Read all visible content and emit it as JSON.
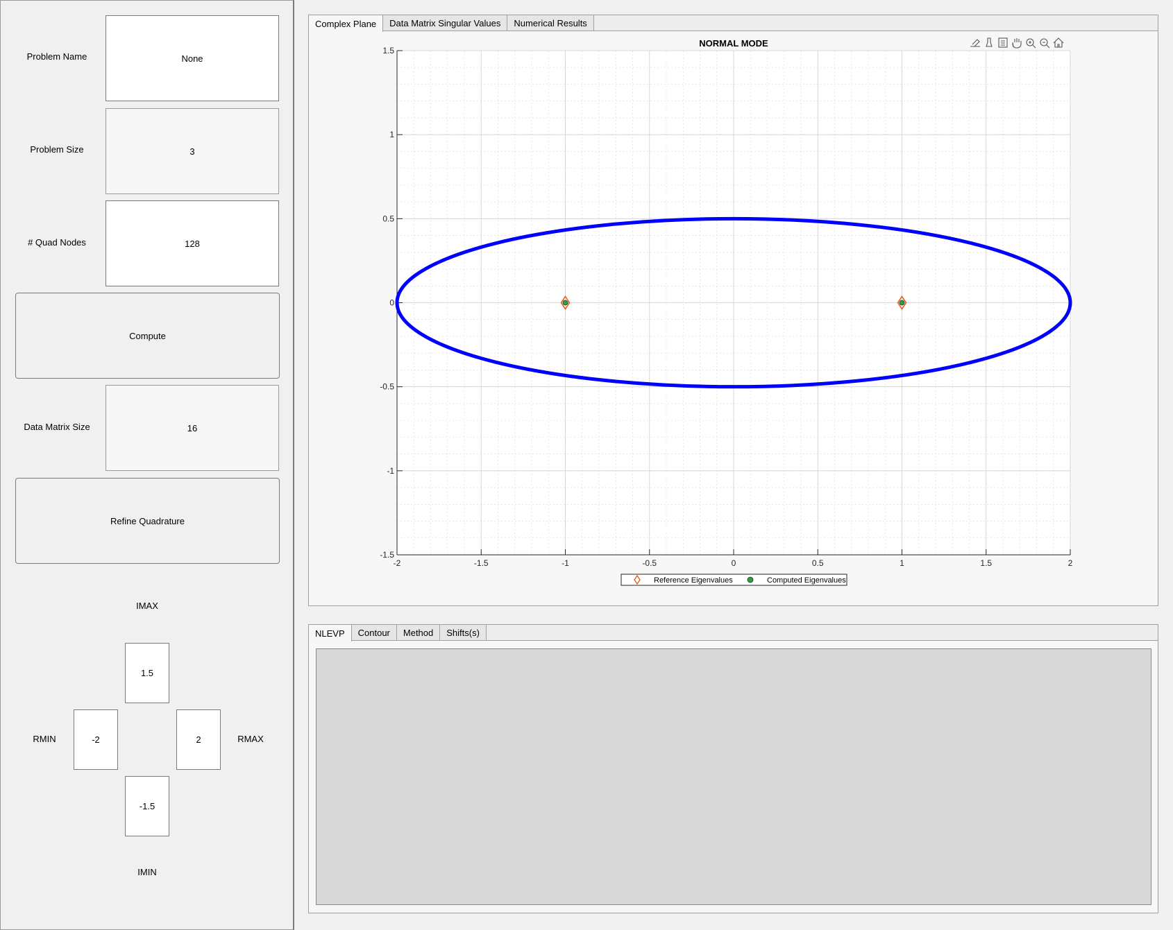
{
  "left": {
    "problem_name": {
      "label": "Problem Name",
      "value": "None"
    },
    "problem_size": {
      "label": "Problem Size",
      "value": "3"
    },
    "quad_nodes": {
      "label": "# Quad Nodes",
      "value": "128"
    },
    "compute_label": "Compute",
    "data_matrix_size": {
      "label": "Data Matrix Size",
      "value": "16"
    },
    "refine_label": "Refine Quadrature",
    "bounds": {
      "imax_label": "IMAX",
      "imax_value": "1.5",
      "rmin_label": "RMIN",
      "rmin_value": "-2",
      "rmax_label": "RMAX",
      "rmax_value": "2",
      "imin_label": "IMIN",
      "imin_value": "-1.5"
    }
  },
  "top_tabs": [
    "Complex Plane",
    "Data Matrix Singular Values",
    "Numerical Results"
  ],
  "bottom_tabs": [
    "NLEVP",
    "Contour",
    "Method",
    "Shifts(s)"
  ],
  "toolbar_icons": [
    "export-icon",
    "brush-icon",
    "data-tips-icon",
    "pan-hand-icon",
    "zoom-in-icon",
    "zoom-out-icon",
    "home-icon"
  ],
  "colors": {
    "contour": "#0000ff",
    "reference_marker": "#e05a10",
    "computed_marker": "#2e9e3e"
  },
  "chart_data": {
    "type": "scatter",
    "title": "NORMAL MODE",
    "xlabel": "",
    "ylabel": "",
    "xlim": [
      -2,
      2
    ],
    "ylim": [
      -1.5,
      1.5
    ],
    "xticks": [
      -2,
      -1.5,
      -1,
      -0.5,
      0,
      0.5,
      1,
      1.5,
      2
    ],
    "yticks": [
      -1.5,
      -1,
      -0.5,
      0,
      0.5,
      1,
      1.5
    ],
    "xtick_labels": [
      "-2",
      "-1.5",
      "-1",
      "-0.5",
      "0",
      "0.5",
      "1",
      "1.5",
      "2"
    ],
    "ytick_labels": [
      "-1.5",
      "-1",
      "-0.5",
      "0",
      "0.5",
      "1",
      "1.5"
    ],
    "grid": true,
    "minor_grid": true,
    "legend_position": "bottom-center",
    "contour": {
      "type": "ellipse",
      "center": [
        0,
        0
      ],
      "radius_real": 2,
      "radius_imag": 0.5
    },
    "series": [
      {
        "name": "Reference Eigenvalues",
        "marker": "diamond",
        "x": [
          -1,
          1
        ],
        "y": [
          0,
          0
        ]
      },
      {
        "name": "Computed Eigenvalues",
        "marker": "circle",
        "x": [
          -1,
          1
        ],
        "y": [
          0,
          0
        ]
      }
    ]
  }
}
